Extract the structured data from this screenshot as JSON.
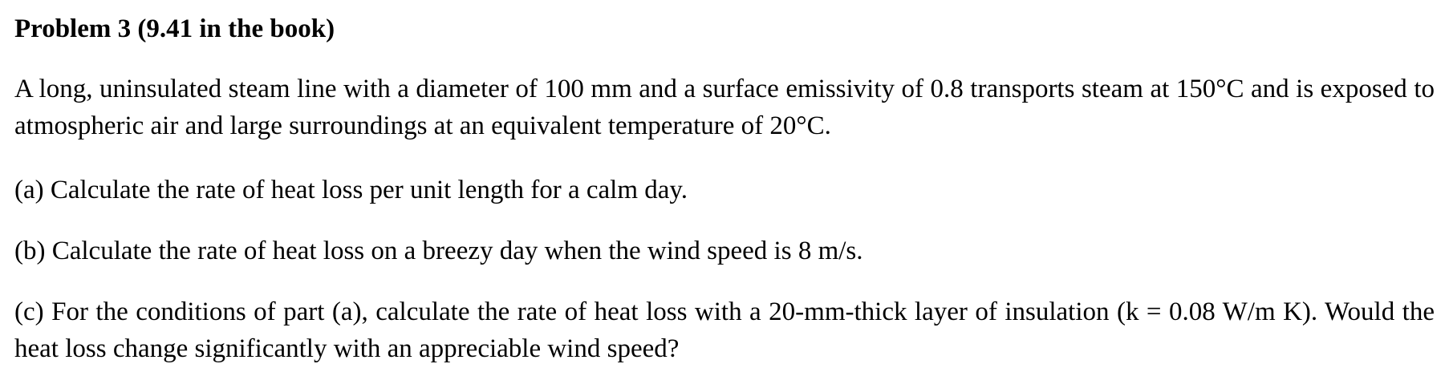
{
  "problem": {
    "title": "Problem 3 (9.41 in the book)",
    "intro": "A long, uninsulated steam line with a diameter of 100 mm and a surface emissivity of 0.8 transports steam at 150°C and is exposed to atmospheric air and large surroundings at an equivalent temperature of 20°C.",
    "parts": [
      {
        "text": "(a) Calculate the rate of heat loss per unit length for a calm day."
      },
      {
        "text": "(b) Calculate the rate of heat loss on a breezy day when the wind speed is 8 m/s."
      },
      {
        "text": "(c) For the conditions of part (a), calculate the rate of heat loss with a 20-mm-thick layer of insulation (k = 0.08 W/m K). Would the heat loss change significantly with an appreciable wind speed?"
      }
    ]
  }
}
